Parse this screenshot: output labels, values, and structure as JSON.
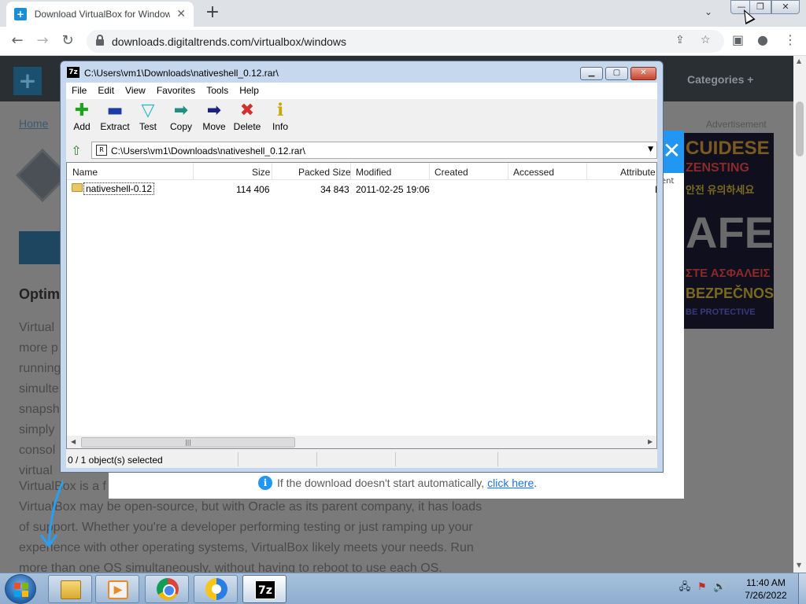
{
  "browser": {
    "tab_title": "Download VirtualBox for Windows",
    "tab_favicon": "+",
    "new_tab": "+",
    "tab_close": "✕",
    "url": "downloads.digitaltrends.com/virtualbox/windows",
    "window_min": "—",
    "window_max": "❐",
    "window_close": "✕"
  },
  "page": {
    "nav_categories": "Categories",
    "breadcrumb_home": "Home",
    "advertisement_label": "Advertisement",
    "ad_lines": [
      "CUIDESE",
      "ZENSTING",
      "안전 유의하세요",
      "AFE",
      "ΣΤΕ ΑΣΦΑΛΕΙΣ",
      "BEZPEČNOST",
      "BE PROTECTIVE"
    ],
    "heading_partial": "Optim",
    "para_fragments": [
      "Virtual",
      "more p",
      "running",
      "simulte",
      "snapsh",
      "simply",
      "consol",
      "virtual"
    ],
    "para_line_1": "VirtualBox is a f",
    "para_line_2": "VirtualBox may be open-source, but with Oracle as its parent company, it has loads",
    "para_line_3": "of support. Whether you're a developer performing testing or just ramping up your",
    "para_line_4": "experience with other operating systems, VirtualBox likely meets your needs. Run",
    "para_line_5": "more than one OS simultaneously, without having to reboot to use each OS."
  },
  "download_dialog": {
    "notice": "If the download doesn't start automatically,",
    "link": "click here",
    "link_suffix": ".",
    "side_text": "ent",
    "close_glyph": "✕"
  },
  "sevenzip": {
    "title": "C:\\Users\\vm1\\Downloads\\nativeshell_0.12.rar\\",
    "title_icon": "7z",
    "menu": [
      "File",
      "Edit",
      "View",
      "Favorites",
      "Tools",
      "Help"
    ],
    "toolbar": [
      {
        "label": "Add",
        "icon": "plus-icon",
        "glyph": "✚",
        "color": "#1fa31f"
      },
      {
        "label": "Extract",
        "icon": "minus-icon",
        "glyph": "▬",
        "color": "#1c3aa9"
      },
      {
        "label": "Test",
        "icon": "check-down-icon",
        "glyph": "▽",
        "color": "#1fb8c9"
      },
      {
        "label": "Copy",
        "icon": "double-arrow-icon",
        "glyph": "➡",
        "color": "#1f8f7f"
      },
      {
        "label": "Move",
        "icon": "arrow-right-icon",
        "glyph": "➡",
        "color": "#1a237e"
      },
      {
        "label": "Delete",
        "icon": "x-icon",
        "glyph": "✖",
        "color": "#d32f2f"
      },
      {
        "label": "Info",
        "icon": "info-icon",
        "glyph": "ℹ",
        "color": "#c9a800"
      }
    ],
    "path": "C:\\Users\\vm1\\Downloads\\nativeshell_0.12.rar\\",
    "columns": [
      "Name",
      "Size",
      "Packed Size",
      "Modified",
      "Created",
      "Accessed",
      "Attribute"
    ],
    "rows": [
      {
        "name": "nativeshell-0.12",
        "size": "114 406",
        "packed": "34 843",
        "modified": "2011-02-25 19:06",
        "created": "",
        "accessed": "",
        "attributes": "D"
      }
    ],
    "status": "0 / 1 object(s) selected"
  },
  "taskbar": {
    "time": "11:40 AM",
    "date": "7/26/2022",
    "sevenzip_icon": "7z"
  }
}
